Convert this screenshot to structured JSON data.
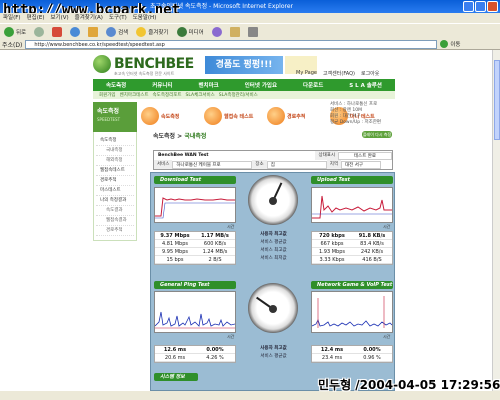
{
  "window": {
    "title": "초고속인터넷 속도측정 - Microsoft Internet Explorer",
    "watermark_url": "http://www.bcpark.net"
  },
  "menu": [
    "파일(F)",
    "편집(E)",
    "보기(V)",
    "즐겨찾기(A)",
    "도구(T)",
    "도움말(H)"
  ],
  "toolbar": {
    "back": "뒤로",
    "search": "검색",
    "favorites": "즐겨찾기",
    "media": "미디어"
  },
  "address": {
    "label": "주소(D)",
    "url": "http://www.benchbee.co.kr/speedtest/speedtest.asp",
    "go": "이동"
  },
  "site": {
    "logo": "BENCHBEE",
    "logo_sub": "초고속 인터넷 속도측정 전문 사이트",
    "banner": "경품도 펑펑!!!",
    "top_links": [
      "My Page",
      "고객센터(FAQ)",
      "로그아웃"
    ],
    "main_nav": [
      "속도측정",
      "커뮤니티",
      "벤치마크",
      "인터넷 가입요",
      "다운로드",
      "S L A 솔루션"
    ],
    "sub_nav": [
      "회원가입",
      "벤치마크테스트",
      "속도측정리포트",
      "SLA체크서비스",
      "SLA측정관리/서비스"
    ]
  },
  "sidebar": {
    "title": "속도측정",
    "subtitle": "SPEEDTEST",
    "items": [
      {
        "label": "속도측정",
        "sub": false
      },
      {
        "label": "국내측정",
        "sub": true
      },
      {
        "label": "해외측정",
        "sub": true
      },
      {
        "label": "웹접속테스트",
        "sub": false
      },
      {
        "label": "경로추적",
        "sub": false
      },
      {
        "label": "마스테스트",
        "sub": false
      },
      {
        "label": "나의 측정결과",
        "sub": false
      },
      {
        "label": "속도결과",
        "sub": true
      },
      {
        "label": "웹접속결과",
        "sub": true
      },
      {
        "label": "경로추적",
        "sub": true
      }
    ]
  },
  "features": [
    {
      "label": "속도측정"
    },
    {
      "label": "웹접속 테스트"
    },
    {
      "label": "경로추적"
    },
    {
      "label": "미니 테스트"
    }
  ],
  "notice": {
    "lines": [
      "서비스 : 하나로통신 프로",
      "회선 : 광랜 10M",
      "회원 : 대전 서구",
      "평균 Down/Up : 저조한편"
    ]
  },
  "section": {
    "title_prefix": "속도측정",
    "title_highlight": "국내측정",
    "help_button": "플레이 다시 측정하기"
  },
  "wan_test": {
    "title": "BenchBee WAN Test",
    "service_label": "서비스",
    "service_value": "하나로통신 케이블 프로",
    "place_label": "장소",
    "place_value": "집",
    "region_label": "지역",
    "region_value": "대전 서구",
    "status_label": "상태표시",
    "status_value": "테스트 완료"
  },
  "download": {
    "title": "Download Test",
    "time_label": "시간",
    "rows": [
      {
        "a": "9.37 Mbps",
        "b": "1.17 MB/s"
      },
      {
        "a": "4.81 Mbps",
        "b": "600 KB/s"
      },
      {
        "a": "9.95 Mbps",
        "b": "1.24 MB/s"
      },
      {
        "a": "15 bps",
        "b": "2 B/S"
      }
    ]
  },
  "upload": {
    "title": "Upload Test",
    "time_label": "시간",
    "rows": [
      {
        "a": "720 kbps",
        "b": "91.8 KB/s"
      },
      {
        "a": "667 kbps",
        "b": "83.4 KB/s"
      },
      {
        "a": "1.93 Mbps",
        "b": "242 KB/s"
      },
      {
        "a": "3.33 Kbps",
        "b": "416 B/S"
      }
    ]
  },
  "speed_labels": [
    "사용자 최고값",
    "서비스 평균값",
    "서비스 최고값",
    "서비스 최저값"
  ],
  "ping": {
    "title": "General Ping Test",
    "time_label": "시간",
    "rows": [
      {
        "a": "12.6 ms",
        "b": "0.00%"
      },
      {
        "a": "20.6 ms",
        "b": "4.26 %"
      }
    ]
  },
  "game": {
    "title": "Network Game & VoIP Test",
    "time_label": "시간",
    "rows": [
      {
        "a": "12.4 ms",
        "b": "0.00%"
      },
      {
        "a": "23.4 ms",
        "b": "0.96 %"
      }
    ]
  },
  "ping_labels": [
    "사용자 최고값",
    "서비스 평균값"
  ],
  "results_title": "시스템 정보",
  "overlay_credit": "민두형 /2004-04-05 17:29:56",
  "colors": {
    "brand_green": "#2f9a2d",
    "dash_bg": "#9bbcd3",
    "download_line": "#c81c3b",
    "upload_line": "#c81c3b",
    "ping_line": "#1a2fb3"
  }
}
